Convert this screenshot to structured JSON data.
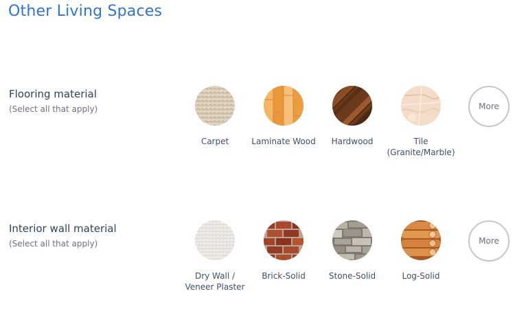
{
  "page": {
    "title": "Other Living Spaces"
  },
  "flooring": {
    "title": "Flooring material",
    "hint": "(Select all that apply)",
    "options": [
      {
        "label": "Carpet",
        "icon": "carpet-texture"
      },
      {
        "label": "Laminate Wood",
        "icon": "laminate-wood-texture"
      },
      {
        "label": "Hardwood",
        "icon": "hardwood-texture"
      },
      {
        "label": "Tile\n(Granite/Marble)",
        "icon": "tile-marble-texture"
      }
    ],
    "more_label": "More"
  },
  "interior_wall": {
    "title": "Interior wall material",
    "hint": "(Select all that apply)",
    "options": [
      {
        "label": "Dry Wall /\nVeneer Plaster",
        "icon": "drywall-texture"
      },
      {
        "label": "Brick-Solid",
        "icon": "brick-texture"
      },
      {
        "label": "Stone-Solid",
        "icon": "stone-texture"
      },
      {
        "label": "Log-Solid",
        "icon": "log-texture"
      }
    ],
    "more_label": "More"
  }
}
